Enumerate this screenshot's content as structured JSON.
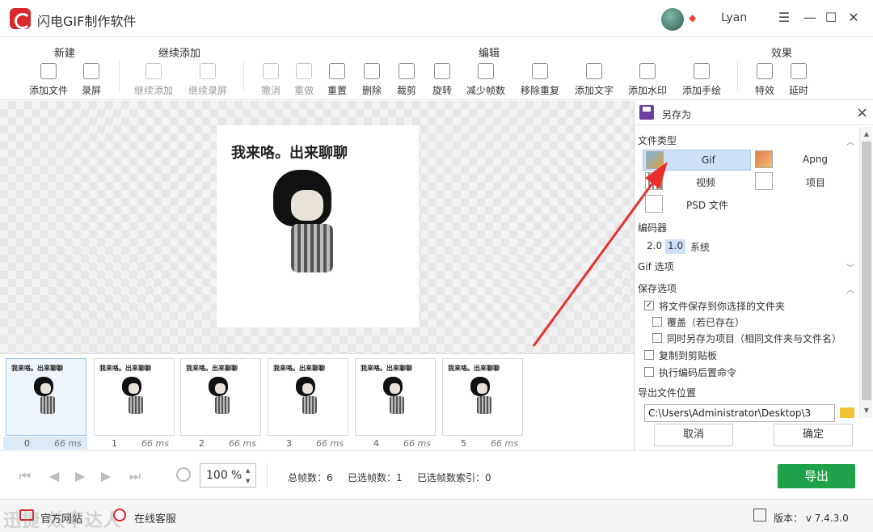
{
  "app": {
    "title": "闪电GIF制作软件",
    "username": "Lyan"
  },
  "window": {
    "minimize": "☰",
    "min": "—",
    "max": "☐",
    "close": "✕"
  },
  "toolbar": {
    "groups": {
      "new": "新建",
      "continue": "继续添加",
      "edit": "编辑",
      "effects": "效果"
    },
    "tools": {
      "add_file": "添加文件",
      "record": "录屏",
      "continue_add": "继续添加",
      "continue_record": "继续录屏",
      "undo": "撤消",
      "redo": "重做",
      "reset": "重置",
      "delete": "删除",
      "crop": "裁剪",
      "rotate": "旋转",
      "reduce_frames": "减少帧数",
      "remove_duplicates": "移除重复",
      "add_text": "添加文字",
      "add_watermark": "添加水印",
      "add_drawing": "添加手绘",
      "effects": "特效",
      "delay": "延时"
    }
  },
  "preview": {
    "caption": "我来咯。出来聊聊"
  },
  "frames": [
    {
      "index": "0",
      "ms": "66 ms",
      "caption": "我来咯。出来聊聊"
    },
    {
      "index": "1",
      "ms": "66 ms",
      "caption": "我来咯。出来聊聊"
    },
    {
      "index": "2",
      "ms": "66 ms",
      "caption": "我来咯。出来聊聊"
    },
    {
      "index": "3",
      "ms": "66 ms",
      "caption": "我来咯。出来聊聊"
    },
    {
      "index": "4",
      "ms": "66 ms",
      "caption": "我来咯。出来聊聊"
    },
    {
      "index": "5",
      "ms": "66 ms",
      "caption": "我来咯。出来聊聊"
    }
  ],
  "panel": {
    "title": "另存为",
    "file_type_label": "文件类型",
    "file_types": {
      "gif": "Gif",
      "apng": "Apng",
      "video": "视频",
      "project": "项目",
      "psd": "PSD 文件"
    },
    "encoder_label": "编码器",
    "encoder_options": {
      "v2": "2.0",
      "v1": "1.0",
      "system": "系统"
    },
    "gif_options_label": "Gif 选项",
    "save_options_label": "保存选项",
    "options": {
      "save_to_folder": "将文件保存到你选择的文件夹",
      "overwrite": "覆盖（若已存在）",
      "save_as_project": "同时另存为项目（相同文件夹与文件名）",
      "copy_clipboard": "复制到剪贴板",
      "post_command": "执行编码后置命令"
    },
    "export_location_label": "导出文件位置",
    "export_path": "C:\\Users\\Administrator\\Desktop\\3",
    "cancel": "取消",
    "confirm": "确定"
  },
  "controls": {
    "zoom_value": "100",
    "zoom_unit": "%",
    "total_frames": "总帧数：6",
    "selected_frames": "已选帧数：1",
    "selected_index": "已选帧数索引：0",
    "export": "导出"
  },
  "statusbar": {
    "website": "官方网站",
    "support": "在线客服",
    "version": "版本： v 7.4.3.0",
    "watermark": "迅捷 效率达人"
  },
  "colors": {
    "accent_red": "#d9272e",
    "export_green": "#1fa24a",
    "selection_blue": "#cde0f7"
  }
}
